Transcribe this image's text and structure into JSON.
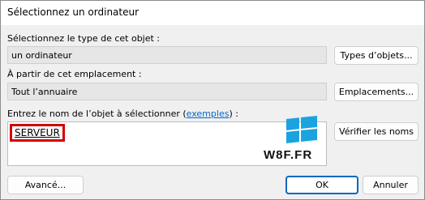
{
  "window": {
    "title": "Sélectionnez un ordinateur"
  },
  "object_type": {
    "label": "Sélectionnez le type de cet objet :",
    "value": "un ordinateur",
    "button": "Types d’objets..."
  },
  "location": {
    "label": "À partir de cet emplacement :",
    "value": "Tout l’annuaire",
    "button": "Emplacements..."
  },
  "names": {
    "label_prefix": "Entrez le nom de l’objet à sélectionner (",
    "label_link": "exemples",
    "label_suffix": ") :",
    "value": "SERVEUR",
    "button": "Vérifier les noms"
  },
  "footer": {
    "advanced": "Avancé...",
    "ok": "OK",
    "cancel": "Annuler"
  },
  "watermark": {
    "text": "W8F.FR",
    "icon": "windows-logo-icon"
  },
  "colors": {
    "accent": "#0067c0",
    "highlight": "#d40000",
    "link": "#0066cc"
  }
}
